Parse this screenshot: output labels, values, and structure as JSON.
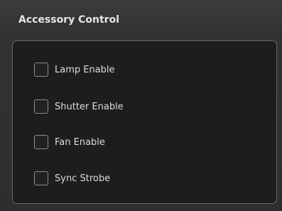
{
  "panel": {
    "title": "Accessory Control"
  },
  "checkboxes": [
    {
      "label": "Lamp Enable",
      "checked": false
    },
    {
      "label": "Shutter Enable",
      "checked": false
    },
    {
      "label": "Fan Enable",
      "checked": false
    },
    {
      "label": "Sync Strobe",
      "checked": false
    }
  ]
}
